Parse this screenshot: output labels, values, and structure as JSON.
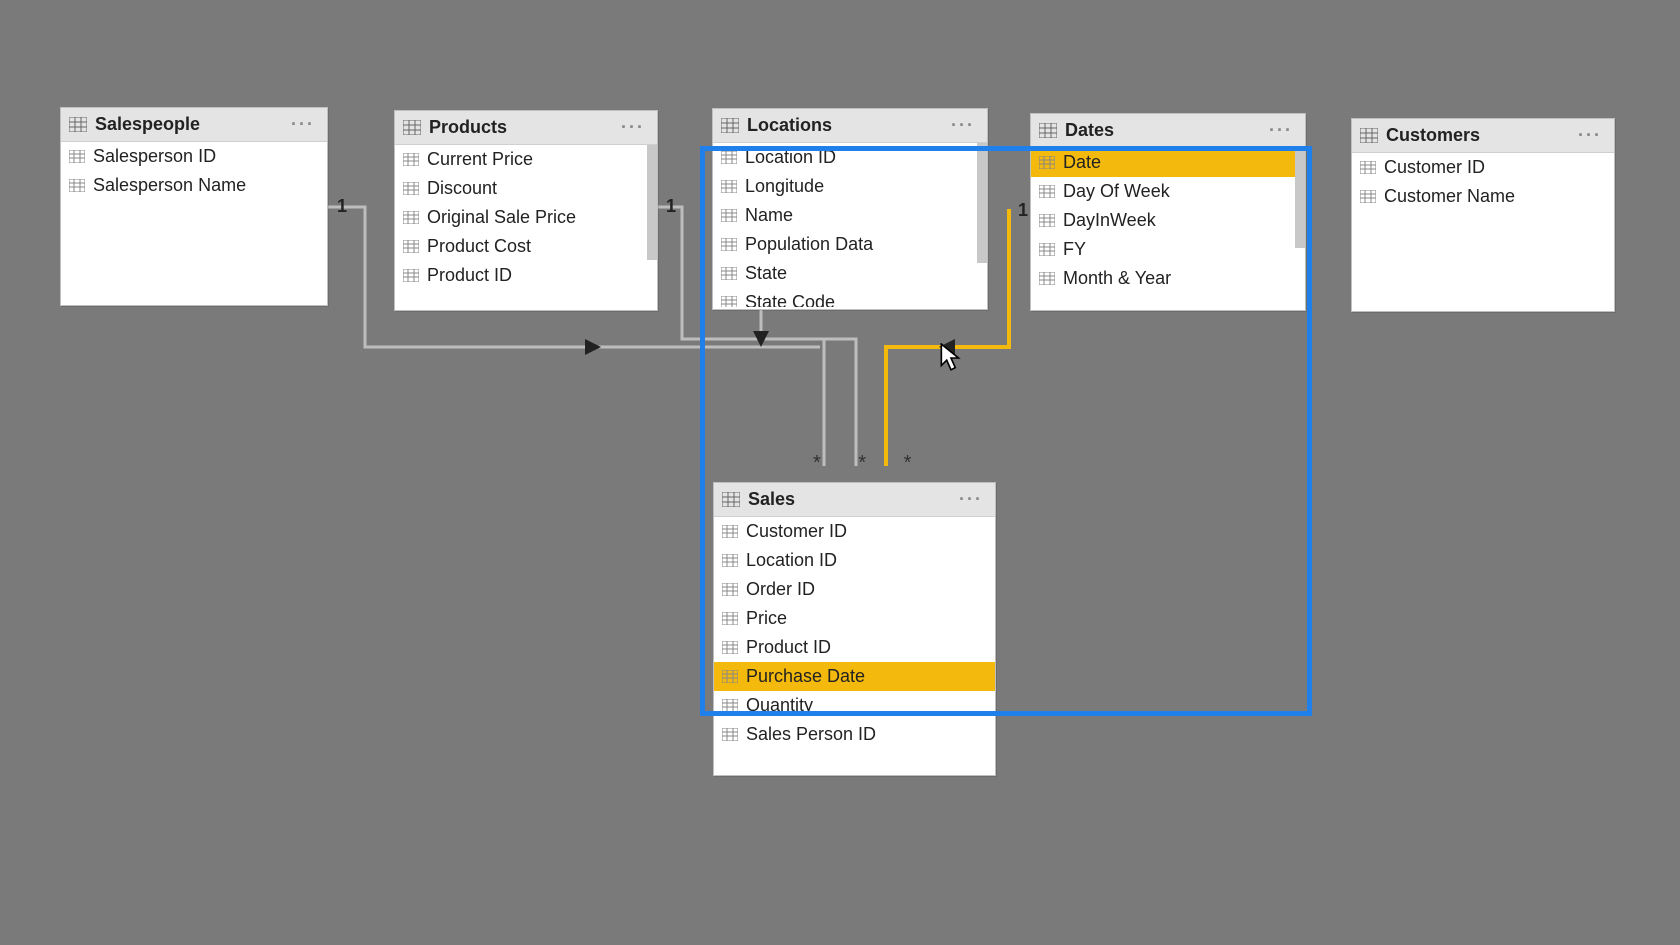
{
  "tables": {
    "salespeople": {
      "title": "Salespeople",
      "fields": [
        "Salesperson ID",
        "Salesperson Name"
      ]
    },
    "products": {
      "title": "Products",
      "fields": [
        "Current Price",
        "Discount",
        "Original Sale Price",
        "Product Cost",
        "Product ID"
      ]
    },
    "locations": {
      "title": "Locations",
      "fields": [
        "Location ID",
        "Longitude",
        "Name",
        "Population Data",
        "State",
        "State Code"
      ]
    },
    "dates": {
      "title": "Dates",
      "fields": [
        "Date",
        "Day Of Week",
        "DayInWeek",
        "FY",
        "Month & Year"
      ]
    },
    "customers": {
      "title": "Customers",
      "fields": [
        "Customer ID",
        "Customer Name"
      ]
    },
    "sales": {
      "title": "Sales",
      "fields": [
        "Customer ID",
        "Location ID",
        "Order ID",
        "Price",
        "Product ID",
        "Purchase Date",
        "Quantity",
        "Sales Person ID"
      ]
    }
  },
  "selected_fields": {
    "dates": "Date",
    "sales": "Purchase Date"
  },
  "cardinalities": {
    "salespeople": "1",
    "products": "1",
    "dates": "1"
  },
  "menu_glyph": "···",
  "many_glyph": "*  *  *"
}
